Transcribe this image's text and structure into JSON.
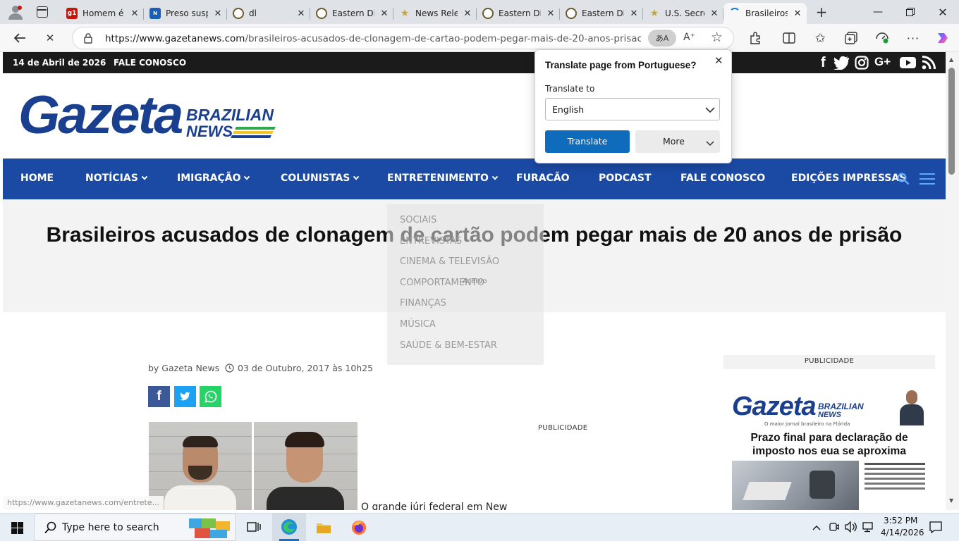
{
  "browser": {
    "tabs": [
      {
        "label": "Homem é",
        "favicon": "g1",
        "color": "#c4170c",
        "active": false
      },
      {
        "label": "Preso susp",
        "favicon": "news-icon",
        "color": "#1b5fb5",
        "active": false
      },
      {
        "label": "dl",
        "favicon": "seal-icon",
        "color": "#6b5a2e",
        "active": false
      },
      {
        "label": "Eastern Di",
        "favicon": "seal-icon",
        "color": "#6b5a2e",
        "active": false
      },
      {
        "label": "News Rele",
        "favicon": "star-badge-icon",
        "color": "#c9a43a",
        "active": false
      },
      {
        "label": "Eastern Di",
        "favicon": "seal-icon",
        "color": "#6b5a2e",
        "active": false
      },
      {
        "label": "Eastern Di",
        "favicon": "seal-icon",
        "color": "#6b5a2e",
        "active": false
      },
      {
        "label": "U.S. Secret",
        "favicon": "star-badge-icon",
        "color": "#c9a43a",
        "active": false
      },
      {
        "label": "Brasileiros",
        "favicon": "loading-icon",
        "color": "#1a73e8",
        "active": true
      }
    ],
    "url_domain": "https://www.gazetanews.com",
    "url_path": "/brasileiros-acusados-de-clonagem-de-cartao-podem-pegar-mais-de-20-anos-prisao/index...",
    "status_url": "https://www.gazetanews.com/entrete..."
  },
  "site": {
    "date": "14 de Abril de 2026",
    "contact": "FALE CONOSCO",
    "logo_main": "Gazeta",
    "logo_line1": "BRAZILIAN",
    "logo_line2": "NEWS",
    "brand_color": "#1b4aa5",
    "nav": [
      {
        "label": "HOME",
        "dropdown": false
      },
      {
        "label": "NOTÍCIAS",
        "dropdown": true
      },
      {
        "label": "IMIGRAÇÃO",
        "dropdown": true
      },
      {
        "label": "COLUNISTAS",
        "dropdown": true
      },
      {
        "label": "ENTRETENIMENTO",
        "dropdown": true
      },
      {
        "label": "FURACÃO",
        "dropdown": false
      },
      {
        "label": "PODCAST",
        "dropdown": false
      },
      {
        "label": "FALE CONOSCO",
        "dropdown": false
      },
      {
        "label": "EDIÇÕES IMPRESSAS",
        "dropdown": false
      }
    ],
    "dropdown_items": [
      "SOCIAIS",
      "ENTREVISTAS",
      "CINEMA & TELEVISÃO",
      "COMPORTAMENTO",
      "FINANÇAS",
      "MÚSICA",
      "SAÚDE & BEM-ESTAR"
    ],
    "dropdown_overlay": "Acervo"
  },
  "article": {
    "title": "Brasileiros acusados de clonagem de cartão podem pegar mais de 20 anos de prisão",
    "author": "by Gazeta News",
    "date": "03 de Outubro, 2017 às 10h25",
    "ad_label": "PUBLICIDADE",
    "body_start": "O grande júri federal em New"
  },
  "sidebar": {
    "ad_label": "PUBLICIDADE",
    "cover_headline_1": "Prazo final para declaração de",
    "cover_headline_2": "imposto nos eua se aproxima",
    "cover_tagline": "O maior jornal brasileiro na Flórida"
  },
  "translate": {
    "title": "Translate page from Portuguese?",
    "label": "Translate to",
    "language": "English",
    "translate_button": "Translate",
    "more_button": "More"
  },
  "taskbar": {
    "search_placeholder": "Type here to search",
    "time": "3:52 PM",
    "date": "4/14/2026"
  }
}
